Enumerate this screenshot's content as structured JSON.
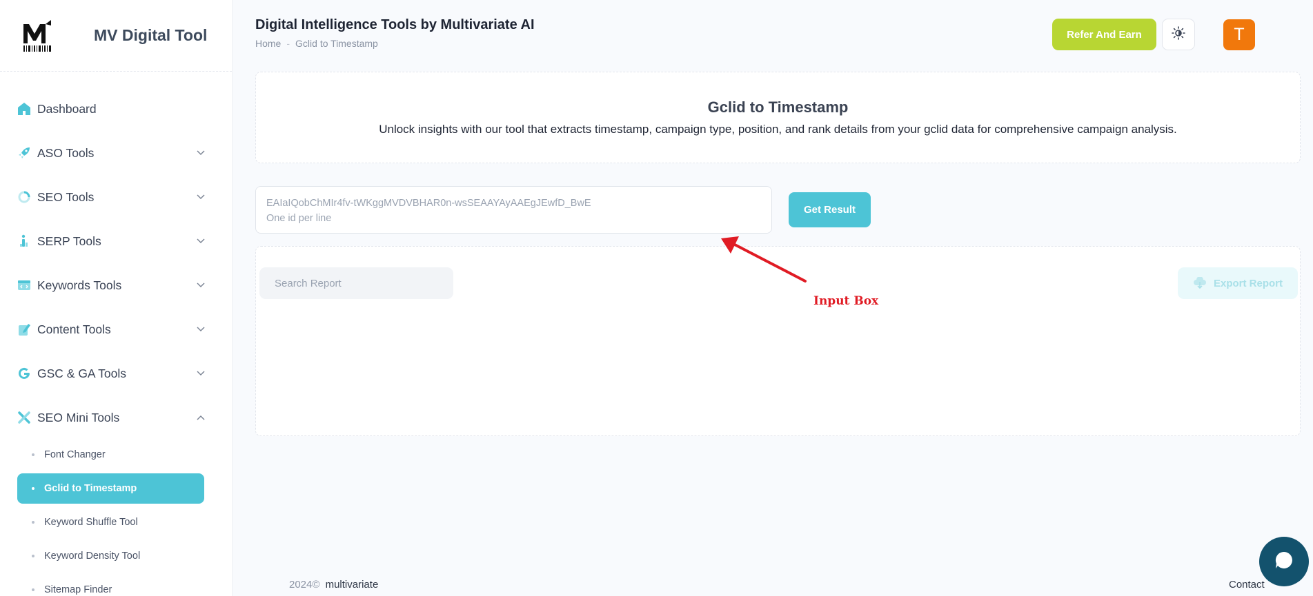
{
  "brand": {
    "title": "MV Digital Tool",
    "logo_icon": "mv-logo-icon"
  },
  "sidebar": {
    "items": [
      {
        "label": "Dashboard",
        "icon": "home-icon",
        "color": "#4dc4d6"
      },
      {
        "label": "ASO Tools",
        "icon": "rocket-icon",
        "color": "#4dc4d6"
      },
      {
        "label": "SEO Tools",
        "icon": "donut-chart-icon",
        "color": "#4dc4d6"
      },
      {
        "label": "SERP Tools",
        "icon": "person-info-icon",
        "color": "#4dc4d6"
      },
      {
        "label": "Keywords Tools",
        "icon": "browser-code-icon",
        "color": "#4dc4d6"
      },
      {
        "label": "Content Tools",
        "icon": "edit-document-icon",
        "color": "#4dc4d6"
      },
      {
        "label": "GSC & GA Tools",
        "icon": "google-icon",
        "color": "#4dc4d6"
      },
      {
        "label": "SEO Mini Tools",
        "icon": "tools-cross-icon",
        "color": "#4dc4d6"
      }
    ],
    "sub_items": [
      {
        "label": "Font Changer"
      },
      {
        "label": "Gclid to Timestamp",
        "active": true
      },
      {
        "label": "Keyword Shuffle Tool"
      },
      {
        "label": "Keyword Density Tool"
      },
      {
        "label": "Sitemap Finder"
      }
    ]
  },
  "header": {
    "title": "Digital Intelligence Tools by Multivariate AI",
    "breadcrumb": [
      "Home",
      "Gclid to Timestamp"
    ],
    "refer_label": "Refer And Earn",
    "refer_color": "#b8d633",
    "theme_icon": "sun-icon",
    "avatar_letter": "T",
    "avatar_color": "#f1780c"
  },
  "intro": {
    "title": "Gclid to Timestamp",
    "description": "Unlock insights with our tool that extracts timestamp, campaign type, position, and rank details from your gclid data for comprehensive campaign analysis."
  },
  "input": {
    "placeholder": "EAIaIQobChMIr4fv-tWKggMVDVBHAR0n-wsSEAAYAyAAEgJEwfD_BwE\nOne id per line",
    "value": ""
  },
  "actions": {
    "get_result_label": "Get Result",
    "accent": "#4dc4d6"
  },
  "report": {
    "search_placeholder": "Search Report",
    "export_label": "Export Report",
    "export_icon": "cloud-download-icon"
  },
  "annotation": {
    "label": "Input Box",
    "color": "#e01b24"
  },
  "footer": {
    "copyright": "2024©",
    "brand": "multivariate",
    "contact": "Contact",
    "chat_icon": "chat-bubble-icon"
  }
}
